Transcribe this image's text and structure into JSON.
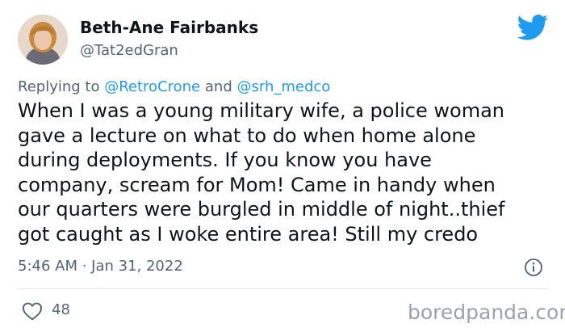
{
  "author": {
    "name": "Beth-Ane Fairbanks",
    "handle": "@Tat2edGran"
  },
  "reply": {
    "prefix": "Replying to",
    "mention1": "@RetroCrone",
    "conjunction": "and",
    "mention2": "@srh_medco"
  },
  "body_lines": [
    "When I was a young military wife, a police woman",
    "gave a lecture on what to do when home alone",
    "during deployments. If you know you have",
    "company, scream for Mom! Came in handy when",
    "our quarters were burgled in middle of night..thief",
    "got caught as I woke entire area! Still my credo"
  ],
  "timestamp": "5:46 AM · Jan 31, 2022",
  "likes": "48",
  "watermark": "boredpanda.com",
  "icons": {
    "brand": "twitter-bird-icon",
    "info": "info-icon",
    "like": "heart-icon"
  },
  "colors": {
    "brand": "#1d9bf0",
    "muted": "#536471",
    "watermark": "#9ba3a9",
    "text": "#0f1419"
  }
}
